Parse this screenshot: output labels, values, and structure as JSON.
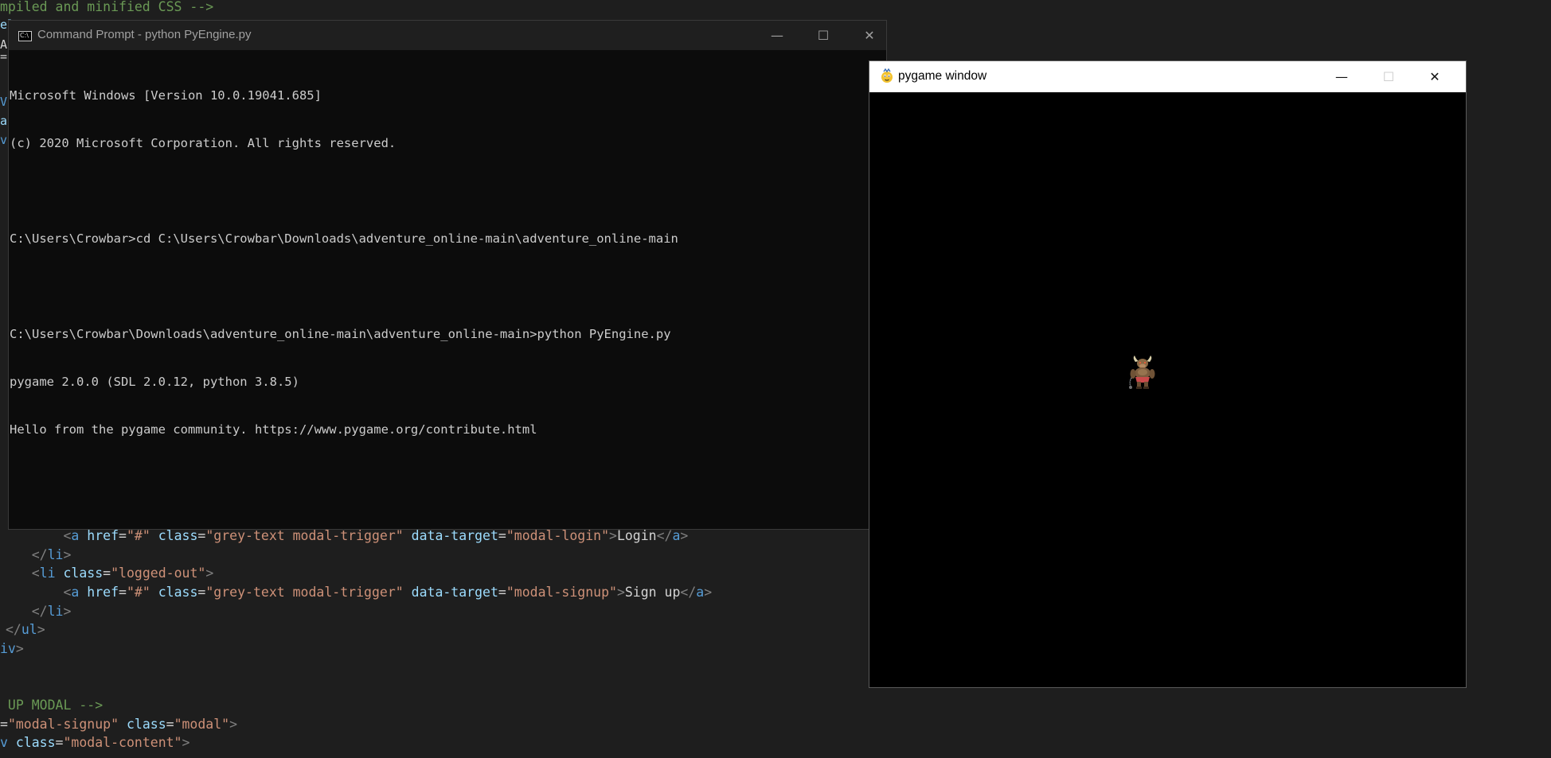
{
  "editor": {
    "lines": [
      {
        "parts": [
          {
            "cls": "tk-comment",
            "t": "mpiled and minified CSS -->"
          }
        ]
      },
      {
        "parts": [
          {
            "cls": "tk-attr",
            "t": "el"
          }
        ]
      },
      {
        "parts": [
          {
            "cls": "tk-text",
            "t": "Ac"
          }
        ]
      },
      {
        "parts": [
          {
            "cls": "tk-text",
            "t": "="
          }
        ]
      },
      {
        "parts": [
          {
            "cls": "tk-tag",
            "t": "Vi"
          }
        ]
      },
      {
        "parts": [
          {
            "cls": "tk-attr",
            "t": "as"
          }
        ]
      },
      {
        "parts": [
          {
            "cls": "tk-tag",
            "t": "v"
          }
        ]
      },
      {
        "parts": [
          {
            "cls": "tk-attr",
            "t": "a"
          }
        ]
      },
      {
        "parts": [
          {
            "cls": "tk-text",
            "t": "<a href=\"#\" class=\"grey-text modal-trigger\" data-target=\"modal-login\">Login</a>"
          }
        ]
      },
      {
        "parts": [
          {
            "cls": "tk-text",
            "t": "</li>"
          }
        ]
      },
      {
        "parts": [
          {
            "cls": "tk-text",
            "t": "<li class=\"logged-out\">"
          }
        ]
      },
      {
        "parts": [
          {
            "cls": "tk-text",
            "t": "<a href=\"#\" class=\"grey-text modal-trigger\" data-target=\"modal-signup\">Sign up</a>"
          }
        ]
      },
      {
        "parts": [
          {
            "cls": "tk-text",
            "t": "</li>"
          }
        ]
      },
      {
        "parts": [
          {
            "cls": "tk-text",
            "t": "</ul>"
          }
        ]
      },
      {
        "parts": [
          {
            "cls": "tk-text",
            "t": "iv>"
          }
        ]
      },
      {
        "parts": [
          {
            "cls": "tk-comment",
            "t": " UP MODAL -->"
          }
        ]
      },
      {
        "parts": [
          {
            "cls": "tk-text",
            "t": "=\"modal-signup\" class=\"modal\">"
          }
        ]
      },
      {
        "parts": [
          {
            "cls": "tk-text",
            "t": "v class=\"modal-content\">"
          }
        ]
      }
    ],
    "login_line": {
      "indent": "        ",
      "tokens": [
        {
          "c": "tk-bracket",
          "t": "<"
        },
        {
          "c": "tk-tag",
          "t": "a"
        },
        {
          "c": "tk-text",
          "t": " "
        },
        {
          "c": "tk-attr",
          "t": "href"
        },
        {
          "c": "tk-text",
          "t": "="
        },
        {
          "c": "tk-str",
          "t": "\"#\""
        },
        {
          "c": "tk-text",
          "t": " "
        },
        {
          "c": "tk-attr",
          "t": "class"
        },
        {
          "c": "tk-text",
          "t": "="
        },
        {
          "c": "tk-str",
          "t": "\"grey-text modal-trigger\""
        },
        {
          "c": "tk-text",
          "t": " "
        },
        {
          "c": "tk-attr",
          "t": "data-target"
        },
        {
          "c": "tk-text",
          "t": "="
        },
        {
          "c": "tk-str",
          "t": "\"modal-login\""
        },
        {
          "c": "tk-bracket",
          "t": ">"
        },
        {
          "c": "tk-text",
          "t": "Login"
        },
        {
          "c": "tk-bracket",
          "t": "</"
        },
        {
          "c": "tk-tag",
          "t": "a"
        },
        {
          "c": "tk-bracket",
          "t": ">"
        }
      ]
    },
    "li_close_1": {
      "indent": "    ",
      "tokens": [
        {
          "c": "tk-bracket",
          "t": "</"
        },
        {
          "c": "tk-tag",
          "t": "li"
        },
        {
          "c": "tk-bracket",
          "t": ">"
        }
      ]
    },
    "li_open": {
      "indent": "    ",
      "tokens": [
        {
          "c": "tk-bracket",
          "t": "<"
        },
        {
          "c": "tk-tag",
          "t": "li"
        },
        {
          "c": "tk-text",
          "t": " "
        },
        {
          "c": "tk-attr",
          "t": "class"
        },
        {
          "c": "tk-text",
          "t": "="
        },
        {
          "c": "tk-str",
          "t": "\"logged-out\""
        },
        {
          "c": "tk-bracket",
          "t": ">"
        }
      ]
    },
    "signup_line": {
      "indent": "        ",
      "tokens": [
        {
          "c": "tk-bracket",
          "t": "<"
        },
        {
          "c": "tk-tag",
          "t": "a"
        },
        {
          "c": "tk-text",
          "t": " "
        },
        {
          "c": "tk-attr",
          "t": "href"
        },
        {
          "c": "tk-text",
          "t": "="
        },
        {
          "c": "tk-str",
          "t": "\"#\""
        },
        {
          "c": "tk-text",
          "t": " "
        },
        {
          "c": "tk-attr",
          "t": "class"
        },
        {
          "c": "tk-text",
          "t": "="
        },
        {
          "c": "tk-str",
          "t": "\"grey-text modal-trigger\""
        },
        {
          "c": "tk-text",
          "t": " "
        },
        {
          "c": "tk-attr",
          "t": "data-target"
        },
        {
          "c": "tk-text",
          "t": "="
        },
        {
          "c": "tk-str",
          "t": "\"modal-signup\""
        },
        {
          "c": "tk-bracket",
          "t": ">"
        },
        {
          "c": "tk-text",
          "t": "Sign up"
        },
        {
          "c": "tk-bracket",
          "t": "</"
        },
        {
          "c": "tk-tag",
          "t": "a"
        },
        {
          "c": "tk-bracket",
          "t": ">"
        }
      ]
    },
    "li_close_2": {
      "indent": "    ",
      "tokens": [
        {
          "c": "tk-bracket",
          "t": "</"
        },
        {
          "c": "tk-tag",
          "t": "li"
        },
        {
          "c": "tk-bracket",
          "t": ">"
        }
      ]
    },
    "ul_close": {
      "indent": "",
      "tokens": [
        {
          "c": "tk-bracket",
          "t": "</"
        },
        {
          "c": "tk-tag",
          "t": "ul"
        },
        {
          "c": "tk-bracket",
          "t": ">"
        }
      ]
    },
    "div_close": {
      "indent": "",
      "tokens": [
        {
          "c": "tk-tag",
          "t": "iv"
        },
        {
          "c": "tk-bracket",
          "t": ">"
        }
      ]
    },
    "modal_comment": {
      "indent": "",
      "tokens": [
        {
          "c": "tk-comment",
          "t": " UP MODAL -->"
        }
      ]
    },
    "modal_div": {
      "indent": "",
      "tokens": [
        {
          "c": "tk-text",
          "t": "="
        },
        {
          "c": "tk-str",
          "t": "\"modal-signup\""
        },
        {
          "c": "tk-text",
          "t": " "
        },
        {
          "c": "tk-attr",
          "t": "class"
        },
        {
          "c": "tk-text",
          "t": "="
        },
        {
          "c": "tk-str",
          "t": "\"modal\""
        },
        {
          "c": "tk-bracket",
          "t": ">"
        }
      ]
    },
    "modal_content": {
      "indent": "",
      "tokens": [
        {
          "c": "tk-tag",
          "t": "v"
        },
        {
          "c": "tk-text",
          "t": " "
        },
        {
          "c": "tk-attr",
          "t": "class"
        },
        {
          "c": "tk-text",
          "t": "="
        },
        {
          "c": "tk-str",
          "t": "\"modal-content\""
        },
        {
          "c": "tk-bracket",
          "t": ">"
        }
      ]
    },
    "top_comment": {
      "indent": "",
      "tokens": [
        {
          "c": "tk-comment",
          "t": "mpiled and minified CSS -->"
        }
      ]
    }
  },
  "cmd": {
    "title": "Command Prompt - python  PyEngine.py",
    "icon_text": "C:\\",
    "minimize_glyph": "—",
    "maximize_glyph": "☐",
    "close_glyph": "✕",
    "output_lines": [
      "Microsoft Windows [Version 10.0.19041.685]",
      "(c) 2020 Microsoft Corporation. All rights reserved.",
      "",
      "C:\\Users\\Crowbar>cd C:\\Users\\Crowbar\\Downloads\\adventure_online-main\\adventure_online-main",
      "",
      "C:\\Users\\Crowbar\\Downloads\\adventure_online-main\\adventure_online-main>python PyEngine.py",
      "pygame 2.0.0 (SDL 2.0.12, python 3.8.5)",
      "Hello from the pygame community. https://www.pygame.org/contribute.html"
    ]
  },
  "pygame": {
    "title": "pygame window",
    "minimize_glyph": "—",
    "maximize_glyph": "☐",
    "close_glyph": "✕",
    "sprite": "minotaur-sprite"
  },
  "colors": {
    "editor_bg": "#1e1e1e",
    "cmd_bg": "#0c0c0c",
    "cmd_titlebar": "#1f1f1f",
    "pygame_bg": "#000000",
    "comment": "#6a9955",
    "tag": "#569cd6",
    "attr": "#9cdcfe",
    "string": "#ce9178"
  }
}
